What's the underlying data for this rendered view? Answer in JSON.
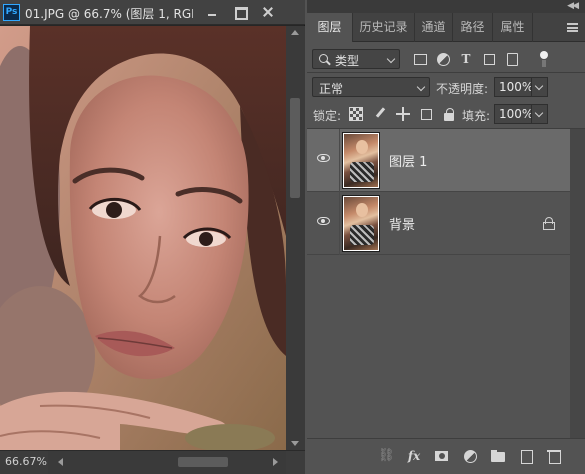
{
  "document": {
    "app_icon": "Ps",
    "title": "01.JPG @ 66.7% (图层 1, RGB...",
    "zoom": "66.67%"
  },
  "panel": {
    "tabs": [
      {
        "label": "图层",
        "active": true
      },
      {
        "label": "历史记录",
        "active": false
      },
      {
        "label": "通道",
        "active": false
      },
      {
        "label": "路径",
        "active": false
      },
      {
        "label": "属性",
        "active": false
      }
    ],
    "filter": {
      "kind": "类型",
      "icons": [
        "pixel-filter-icon",
        "adjustment-filter-icon",
        "type-filter-icon",
        "shape-filter-icon",
        "smart-object-filter-icon",
        "filter-toggle-icon"
      ]
    },
    "blend_mode": "正常",
    "opacity_label": "不透明度:",
    "opacity": "100%",
    "lock_label": "锁定:",
    "fill_label": "填充:",
    "fill": "100%",
    "layers": [
      {
        "name": "图层 1",
        "visible": true,
        "selected": true,
        "locked": false
      },
      {
        "name": "背景",
        "visible": true,
        "selected": false,
        "locked": true
      }
    ],
    "bottom_icons": [
      "link-layers-icon",
      "fx-icon",
      "add-mask-icon",
      "new-adjustment-icon",
      "new-group-icon",
      "new-layer-icon",
      "delete-layer-icon"
    ],
    "fx_label": "fx",
    "type_tool_label": "T"
  },
  "colors": {
    "panel_bg": "#535353",
    "selected_row": "#6a6a6a",
    "ps_blue": "#31a8ff"
  }
}
